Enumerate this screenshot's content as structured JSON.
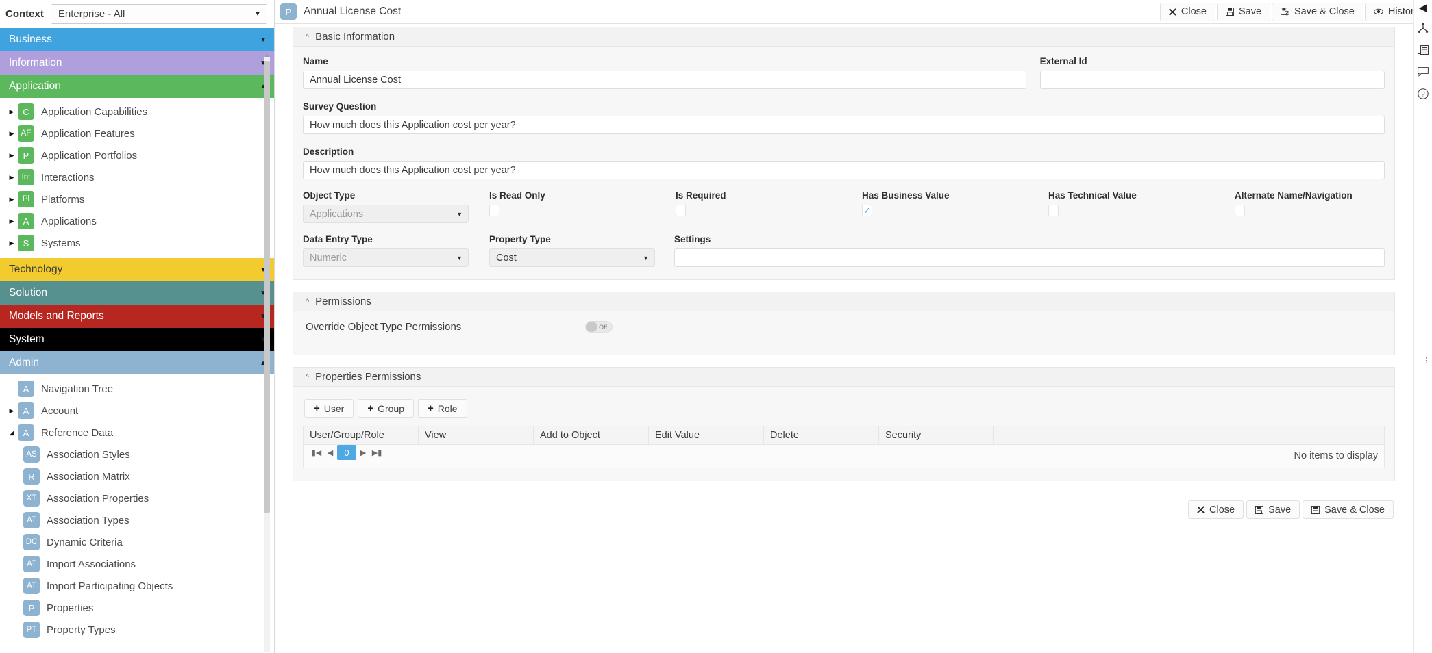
{
  "context": {
    "label": "Context",
    "value": "Enterprise - All",
    "caret": "chevron-down"
  },
  "sidebar": {
    "groups": [
      {
        "name": "Business",
        "color": "#3fa3e0",
        "expanded": false,
        "marker": "▼"
      },
      {
        "name": "Information",
        "color": "#b09fdd",
        "expanded": false,
        "marker": "▼"
      },
      {
        "name": "Application",
        "color": "#5cb85c",
        "expanded": true,
        "marker": "▲"
      },
      {
        "name": "Technology",
        "color": "#f2cb2e",
        "expanded": false,
        "marker": "▼"
      },
      {
        "name": "Solution",
        "color": "#56908f",
        "expanded": false,
        "marker": "▼"
      },
      {
        "name": "Models and Reports",
        "color": "#b7271f",
        "expanded": false,
        "marker": "▼"
      },
      {
        "name": "System",
        "color": "#000000",
        "expanded": false,
        "marker": "▼"
      },
      {
        "name": "Admin",
        "color": "#8db3d1",
        "expanded": true,
        "marker": "▲"
      }
    ],
    "application_items": [
      {
        "abbr": "C",
        "label": "Application Capabilities",
        "expandable": true
      },
      {
        "abbr": "AF",
        "label": "Application Features",
        "expandable": true
      },
      {
        "abbr": "P",
        "label": "Application Portfolios",
        "expandable": true
      },
      {
        "abbr": "Int",
        "label": "Interactions",
        "expandable": true
      },
      {
        "abbr": "Pl",
        "label": "Platforms",
        "expandable": true
      },
      {
        "abbr": "A",
        "label": "Applications",
        "expandable": true
      },
      {
        "abbr": "S",
        "label": "Systems",
        "expandable": true
      }
    ],
    "admin_items": [
      {
        "abbr": "A",
        "label": "Navigation Tree",
        "expandable": false,
        "child": false
      },
      {
        "abbr": "A",
        "label": "Account",
        "expandable": true,
        "child": false
      },
      {
        "abbr": "A",
        "label": "Reference Data",
        "expandable": true,
        "expanded": true,
        "child": false
      },
      {
        "abbr": "AS",
        "label": "Association Styles",
        "child": true
      },
      {
        "abbr": "R",
        "label": "Association Matrix",
        "child": true
      },
      {
        "abbr": "XT",
        "label": "Association Properties",
        "child": true
      },
      {
        "abbr": "AT",
        "label": "Association Types",
        "child": true
      },
      {
        "abbr": "DC",
        "label": "Dynamic Criteria",
        "child": true
      },
      {
        "abbr": "AT",
        "label": "Import Associations",
        "child": true
      },
      {
        "abbr": "AT",
        "label": "Import Participating Objects",
        "child": true
      },
      {
        "abbr": "P",
        "label": "Properties",
        "child": true
      },
      {
        "abbr": "PT",
        "label": "Property Types",
        "child": true
      }
    ]
  },
  "topbar": {
    "record_badge": "P",
    "title": "Annual License Cost",
    "close_label": "Close",
    "save_label": "Save",
    "save_close_label": "Save & Close",
    "history_label": "History"
  },
  "basic_information": {
    "section_title": "Basic Information",
    "name_label": "Name",
    "name_value": "Annual License Cost",
    "external_id_label": "External Id",
    "external_id_value": "",
    "survey_question_label": "Survey Question",
    "survey_question_value": "How much does this Application cost per year?",
    "description_label": "Description",
    "description_value": "How much does this Application cost per year?",
    "object_type_label": "Object Type",
    "object_type_value": "Applications",
    "is_read_only_label": "Is Read Only",
    "is_read_only_checked": false,
    "is_required_label": "Is Required",
    "is_required_checked": false,
    "has_business_value_label": "Has Business Value",
    "has_business_value_checked": true,
    "has_technical_value_label": "Has Technical Value",
    "has_technical_value_checked": false,
    "alternate_name_label": "Alternate Name/Navigation",
    "alternate_name_checked": false,
    "data_entry_type_label": "Data Entry Type",
    "data_entry_type_value": "Numeric",
    "property_type_label": "Property Type",
    "property_type_value": "Cost",
    "settings_label": "Settings",
    "settings_value": ""
  },
  "permissions": {
    "section_title": "Permissions",
    "override_label": "Override Object Type Permissions",
    "override_state": "Off"
  },
  "properties_permissions": {
    "section_title": "Properties Permissions",
    "add_user_label": "User",
    "add_group_label": "Group",
    "add_role_label": "Role",
    "columns": [
      "User/Group/Role",
      "View",
      "Add to Object",
      "Edit Value",
      "Delete",
      "Security",
      ""
    ],
    "page_number": "0",
    "empty_message": "No items to display"
  },
  "footer": {
    "close_label": "Close",
    "save_label": "Save",
    "save_close_label": "Save & Close"
  },
  "right_rail": {
    "collapse": "collapse-panel",
    "icons": [
      "hierarchy-icon",
      "notes-icon",
      "comment-icon",
      "help-icon"
    ]
  },
  "colors": {
    "accent_blue": "#4ea8e4",
    "check_blue": "#3c9ddb",
    "admin_blue": "#8db3d1",
    "app_green": "#5cb85c"
  }
}
